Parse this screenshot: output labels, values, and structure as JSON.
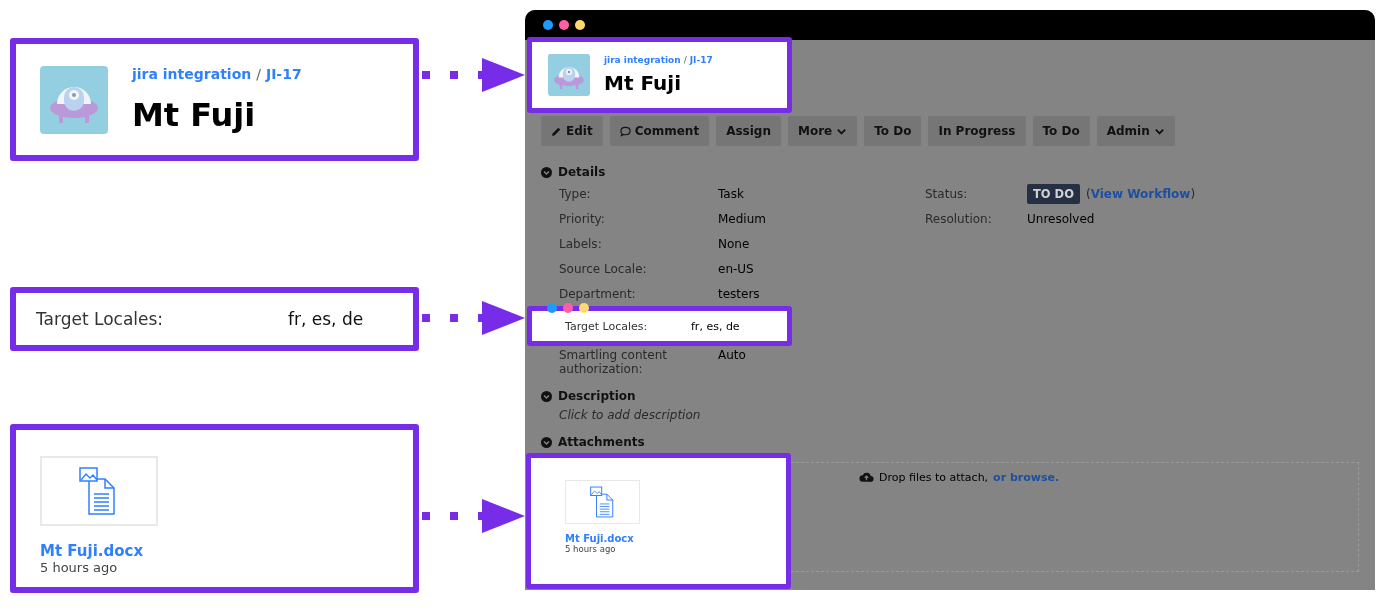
{
  "callouts": {
    "header": {
      "project": "jira integration",
      "separator": "/",
      "issue": "JI-17",
      "title": "Mt Fuji"
    },
    "locales": {
      "label": "Target Locales:",
      "value": "fr, es, de"
    },
    "attachment": {
      "name": "Mt Fuji.docx",
      "time": "5 hours ago"
    }
  },
  "issue": {
    "project": "jira integration",
    "separator": "/",
    "issue": "JI-17",
    "title": "Mt Fuji",
    "buttons": [
      {
        "label": "Edit",
        "kind": "edit"
      },
      {
        "label": "Comment",
        "kind": "comment"
      },
      {
        "label": "Assign",
        "kind": "plain"
      },
      {
        "label": "More",
        "kind": "dropdown"
      },
      {
        "label": "To Do",
        "kind": "plain"
      },
      {
        "label": "In Progress",
        "kind": "plain"
      },
      {
        "label": "To Do",
        "kind": "plain"
      },
      {
        "label": "Admin",
        "kind": "dropdown"
      }
    ],
    "details": {
      "heading": "Details",
      "fields": [
        {
          "label": "Type:",
          "value": "Task",
          "highlighted": false
        },
        {
          "label": "Priority:",
          "value": "Medium",
          "highlighted": false
        },
        {
          "label": "Labels:",
          "value": "None",
          "highlighted": false
        },
        {
          "label": "Source Locale:",
          "value": "en-US",
          "highlighted": false
        },
        {
          "label": "Department:",
          "value": "testers",
          "highlighted": false
        },
        {
          "label": "Target Locales:",
          "value": "fr, es, de",
          "highlighted": true
        },
        {
          "label": "Smartling content authorization:",
          "value": "Auto",
          "highlighted": false
        }
      ],
      "side_fields": [
        {
          "label": "Status:",
          "kind": "badge",
          "value": "TO DO",
          "open": "(",
          "link": "View Workflow",
          "close": ")"
        },
        {
          "label": "Resolution:",
          "kind": "text",
          "value": "Unresolved"
        }
      ]
    },
    "description": {
      "heading": "Description",
      "placeholder": "Click to add description"
    },
    "attachments": {
      "heading": "Attachments",
      "drop_text": "Drop files to attach,",
      "drop_link": "or browse.",
      "files": [
        {
          "name": "Mt Fuji.docx",
          "time": "5 hours ago",
          "highlighted": true
        }
      ]
    }
  }
}
